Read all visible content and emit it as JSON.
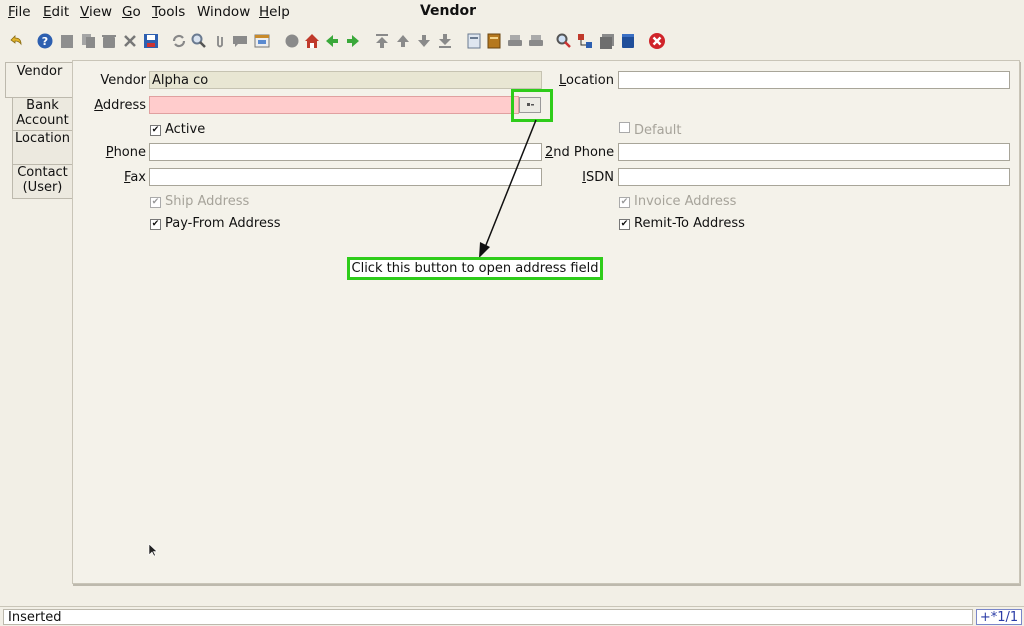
{
  "menu": {
    "file_first": "F",
    "file_rest": "ile",
    "edit_first": "E",
    "edit_rest": "dit",
    "view_first": "V",
    "view_rest": "iew",
    "go_first": "G",
    "go_rest": "o",
    "tools_first": "T",
    "tools_rest": "ools",
    "window": "Window",
    "help_first": "H",
    "help_rest": "elp"
  },
  "window_title": "Vendor",
  "toolbar_icons": [
    "undo-icon",
    "help-icon",
    "new-icon",
    "copy-icon",
    "delete-icon",
    "delete-selection-icon",
    "save-icon",
    "refresh-icon",
    "find-icon",
    "attachment-icon",
    "chat-icon",
    "history-icon",
    "report-icon",
    "home-icon",
    "back-icon",
    "forward-icon",
    "first-record-icon",
    "previous-record-icon",
    "next-record-icon",
    "last-record-icon",
    "detail-icon",
    "archive-icon",
    "print-preview-icon",
    "print-icon",
    "zoom-across-icon",
    "workflow-icon",
    "request-icon",
    "product-info-icon",
    "exit-icon"
  ],
  "tabs": [
    {
      "label_1": "Vendor",
      "label_2": ""
    },
    {
      "label_1": "Bank",
      "label_2": "Account"
    },
    {
      "label_1": "Location",
      "label_2": ""
    },
    {
      "label_1": "Contact",
      "label_2": "(User)"
    }
  ],
  "form": {
    "vendor_label": "Vendor",
    "vendor_value": "Alpha co",
    "address_label_first": "A",
    "address_label_rest": "ddress",
    "address_value": "",
    "active_label": "Active",
    "location_label_first": "L",
    "location_label_rest": "ocation",
    "location_value": "",
    "default_label": "Default",
    "phone_label_first": "P",
    "phone_label_rest": "hone",
    "phone_value": "",
    "phone2_label_first": "2",
    "phone2_label_rest": "nd Phone",
    "phone2_value": "",
    "fax_label_first": "F",
    "fax_label_rest": "ax",
    "fax_value": "",
    "isdn_label_first": "I",
    "isdn_label_rest": "SDN",
    "isdn_value": "",
    "ship_address_label": "Ship Address",
    "invoice_address_label": "Invoice Address",
    "payfrom_address_label": "Pay-From Address",
    "remitto_address_label": "Remit-To Address"
  },
  "callout_text": "Click this button to open address field",
  "colors": {
    "highlight": "#2ecc1a",
    "mandatory": "#ffcccc",
    "readonly": "#e8e6d3"
  },
  "status": {
    "text": "Inserted",
    "record": "+*1/1"
  }
}
